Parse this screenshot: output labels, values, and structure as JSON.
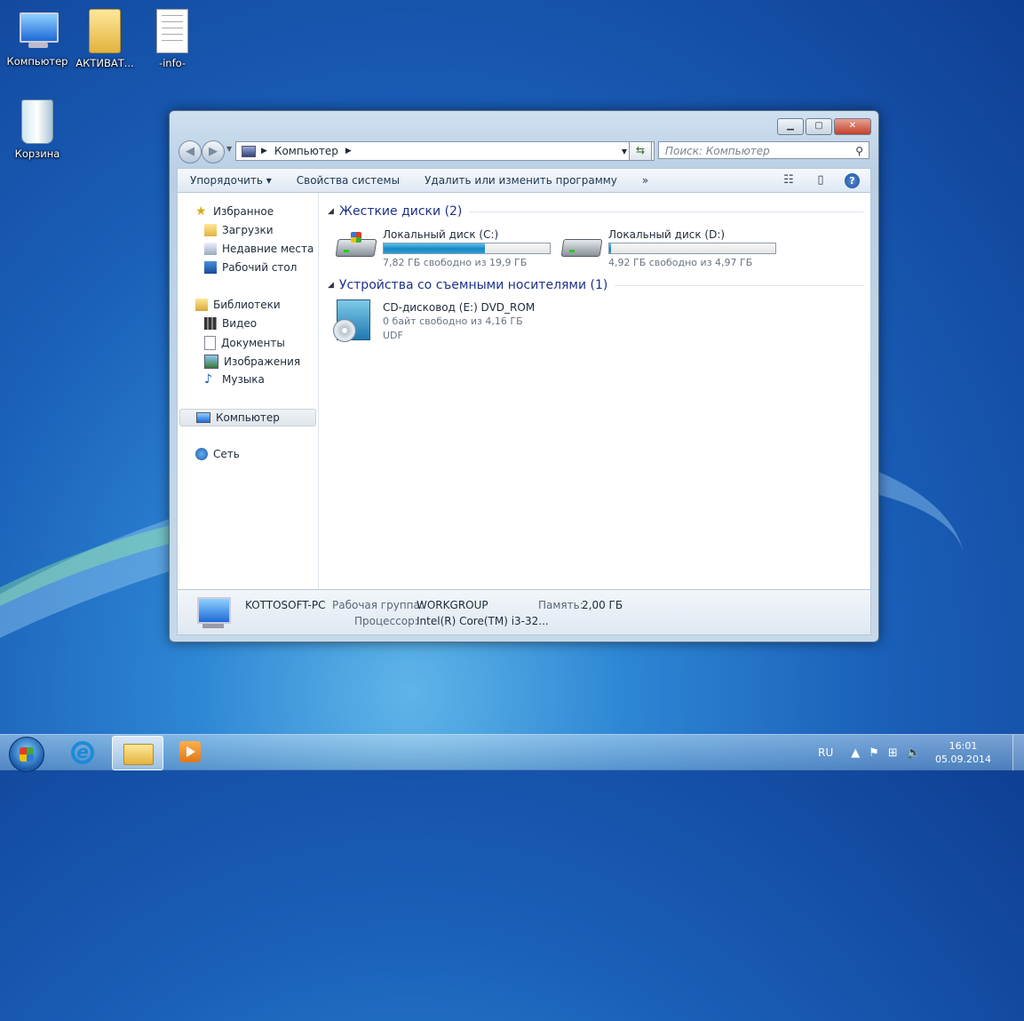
{
  "desktop": {
    "icons": [
      {
        "label": "Компьютер"
      },
      {
        "label": "АКТИВАТ..."
      },
      {
        "label": "-info-"
      },
      {
        "label": "Корзина"
      }
    ]
  },
  "window": {
    "address": {
      "path_item": "Компьютер",
      "search_placeholder": "Поиск: Компьютер"
    },
    "toolbar": {
      "organize": "Упорядочить ▾",
      "system_properties": "Свойства системы",
      "uninstall": "Удалить или изменить программу",
      "more": "»"
    },
    "sidebar": {
      "favorites": "Избранное",
      "downloads": "Загрузки",
      "recent": "Недавние места",
      "desktop": "Рабочий стол",
      "libraries": "Библиотеки",
      "video": "Видео",
      "documents": "Документы",
      "pictures": "Изображения",
      "music": "Музыка",
      "computer": "Компьютер",
      "network": "Сеть"
    },
    "groups": {
      "hard_disks": "Жесткие диски (2)",
      "removable": "Устройства со съемными носителями (1)"
    },
    "drives": [
      {
        "name": "Локальный диск (C:)",
        "free": "7,82 ГБ свободно из 19,9 ГБ",
        "used_fraction": 0.61
      },
      {
        "name": "Локальный диск (D:)",
        "free": "4,92 ГБ свободно из 4,97 ГБ",
        "used_fraction": 0.01
      }
    ],
    "cd": {
      "name": "CD-дисковод (E:) DVD_ROM",
      "free": "0 байт свободно из 4,16 ГБ",
      "fs": "UDF"
    },
    "details": {
      "pc_name": "KOTTOSOFT-PC",
      "workgroup_label": "Рабочая группа:",
      "workgroup": "WORKGROUP",
      "memory_label": "Память:",
      "memory": "2,00 ГБ",
      "cpu_label": "Процессор:",
      "cpu": "Intel(R) Core(TM) i3-32..."
    }
  },
  "taskbar": {
    "lang": "RU",
    "time": "16:01",
    "date": "05.09.2014"
  },
  "colors": {
    "accent": "#1e3287",
    "drive_fill": "#26a0d8"
  }
}
